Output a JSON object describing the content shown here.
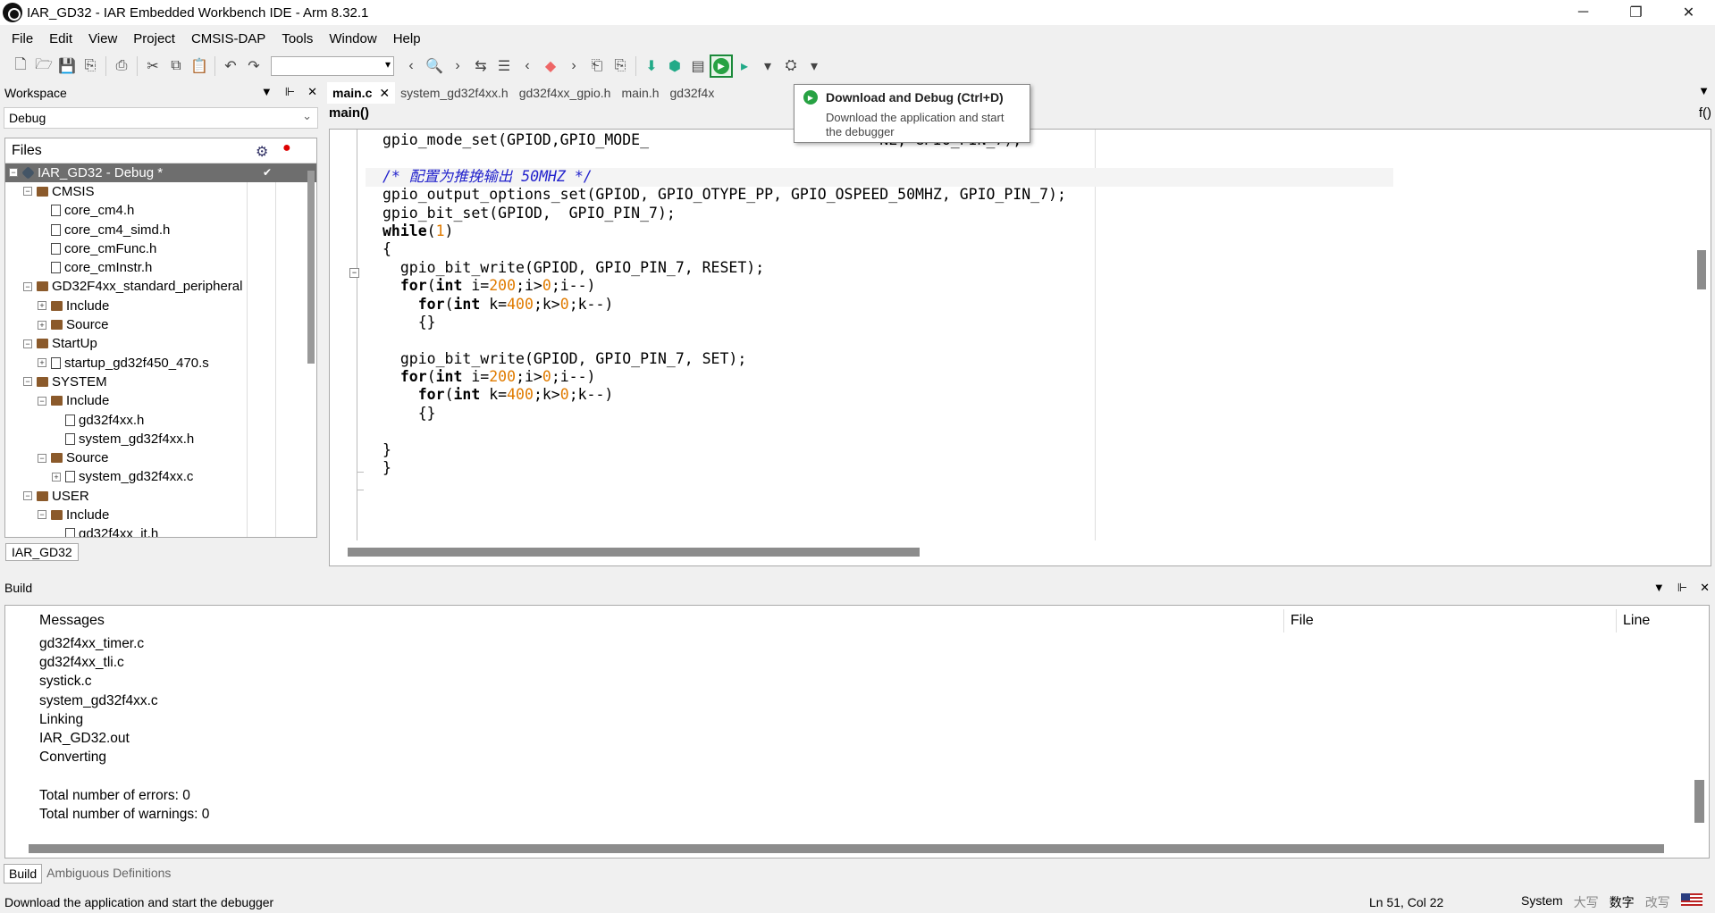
{
  "window": {
    "title": "IAR_GD32 - IAR Embedded Workbench IDE - Arm 8.32.1",
    "controls": [
      "─",
      "❐",
      "✕"
    ]
  },
  "menu": [
    "File",
    "Edit",
    "View",
    "Project",
    "CMSIS-DAP",
    "Tools",
    "Window",
    "Help"
  ],
  "toolbar": {
    "search_value": "",
    "tooltip": {
      "title": "Download and Debug (Ctrl+D)",
      "body": "Download the application and start the debugger"
    }
  },
  "workspace": {
    "title": "Workspace",
    "config": "Debug",
    "files_label": "Files",
    "tab": "IAR_GD32",
    "tree": [
      {
        "label": "IAR_GD32 - Debug *",
        "depth": 0,
        "kind": "project",
        "expander": "−",
        "selected": true,
        "checked": "✔"
      },
      {
        "label": "CMSIS",
        "depth": 1,
        "kind": "folder",
        "expander": "−"
      },
      {
        "label": "core_cm4.h",
        "depth": 2,
        "kind": "file",
        "expander": ""
      },
      {
        "label": "core_cm4_simd.h",
        "depth": 2,
        "kind": "file",
        "expander": ""
      },
      {
        "label": "core_cmFunc.h",
        "depth": 2,
        "kind": "file",
        "expander": ""
      },
      {
        "label": "core_cmInstr.h",
        "depth": 2,
        "kind": "file",
        "expander": ""
      },
      {
        "label": "GD32F4xx_standard_peripheral",
        "depth": 1,
        "kind": "folder",
        "expander": "−"
      },
      {
        "label": "Include",
        "depth": 2,
        "kind": "folder",
        "expander": "+"
      },
      {
        "label": "Source",
        "depth": 2,
        "kind": "folder",
        "expander": "+"
      },
      {
        "label": "StartUp",
        "depth": 1,
        "kind": "folder",
        "expander": "−"
      },
      {
        "label": "startup_gd32f450_470.s",
        "depth": 2,
        "kind": "file",
        "expander": "+"
      },
      {
        "label": "SYSTEM",
        "depth": 1,
        "kind": "folder",
        "expander": "−"
      },
      {
        "label": "Include",
        "depth": 2,
        "kind": "folder",
        "expander": "−"
      },
      {
        "label": "gd32f4xx.h",
        "depth": 3,
        "kind": "file",
        "expander": ""
      },
      {
        "label": "system_gd32f4xx.h",
        "depth": 3,
        "kind": "file",
        "expander": ""
      },
      {
        "label": "Source",
        "depth": 2,
        "kind": "folder",
        "expander": "−"
      },
      {
        "label": "system_gd32f4xx.c",
        "depth": 3,
        "kind": "file",
        "expander": "+"
      },
      {
        "label": "USER",
        "depth": 1,
        "kind": "folder",
        "expander": "−"
      },
      {
        "label": "Include",
        "depth": 2,
        "kind": "folder",
        "expander": "−"
      },
      {
        "label": "gd32f4xx_it.h",
        "depth": 3,
        "kind": "file",
        "expander": ""
      }
    ]
  },
  "editor": {
    "tabs": [
      "main.c",
      "system_gd32f4xx.h",
      "gd32f4xx_gpio.h",
      "main.h",
      "gd32f4x"
    ],
    "active_tab": "main.c",
    "function": "main()",
    "func_icon": "f()",
    "lines": [
      "gpio_mode_set(GPIOD,GPIO_MODE_                          NE, GPIO_PIN_7);",
      "",
      "/* 配置为推挽输出 50MHZ */",
      "gpio_output_options_set(GPIOD, GPIO_OTYPE_PP, GPIO_OSPEED_50MHZ, GPIO_PIN_7);",
      "gpio_bit_set(GPIOD,  GPIO_PIN_7);",
      "while(1)",
      "{",
      "  gpio_bit_write(GPIOD, GPIO_PIN_7, RESET);",
      "  for(int i=200;i>0;i--)",
      "    for(int k=400;k>0;k--)",
      "    {}",
      "",
      "  gpio_bit_write(GPIOD, GPIO_PIN_7, SET);",
      "  for(int i=200;i>0;i--)",
      "    for(int k=400;k>0;k--)",
      "    {}",
      "",
      "}",
      "}"
    ]
  },
  "build": {
    "title": "Build",
    "columns": {
      "messages": "Messages",
      "file": "File",
      "line": "Line"
    },
    "messages": [
      "gd32f4xx_timer.c",
      "gd32f4xx_tli.c",
      "systick.c",
      "system_gd32f4xx.c",
      "Linking",
      "IAR_GD32.out",
      "Converting",
      "",
      "Total number of errors: 0",
      "Total number of warnings: 0"
    ],
    "tabs": [
      "Build",
      "Ambiguous Definitions"
    ]
  },
  "status": {
    "message": "Download the application and start the debugger",
    "position": "Ln 51, Col 22",
    "indicators": [
      "System",
      "大写",
      "数字",
      "改写"
    ]
  }
}
